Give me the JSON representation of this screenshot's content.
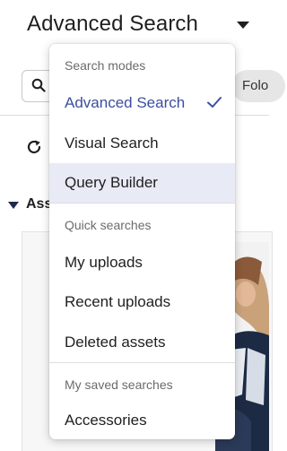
{
  "header": {
    "title": "Advanced Search"
  },
  "toolbar": {
    "folder_label": "Folo"
  },
  "assets": {
    "label": "Ass"
  },
  "menu": {
    "sections": [
      {
        "heading": "Search modes"
      },
      {
        "heading": "Quick searches"
      },
      {
        "heading": "My saved searches"
      }
    ],
    "search_modes": [
      {
        "label": "Advanced Search",
        "selected": true
      },
      {
        "label": "Visual Search",
        "selected": false
      },
      {
        "label": "Query Builder",
        "selected": false
      }
    ],
    "quick_searches": [
      {
        "label": "My uploads"
      },
      {
        "label": "Recent uploads"
      },
      {
        "label": "Deleted assets"
      }
    ],
    "saved_searches": [
      {
        "label": "Accessories"
      }
    ]
  },
  "colors": {
    "accent": "#3a4fa0",
    "hover_background": "#e8eaf6",
    "text": "#1f1f1f",
    "muted_text": "#6b6b6b"
  },
  "icons": {
    "title_dropdown": "caret-down-icon",
    "search": "search-icon",
    "refresh": "refresh-icon",
    "assets_toggle": "caret-down-icon",
    "selected_mark": "check-icon"
  }
}
